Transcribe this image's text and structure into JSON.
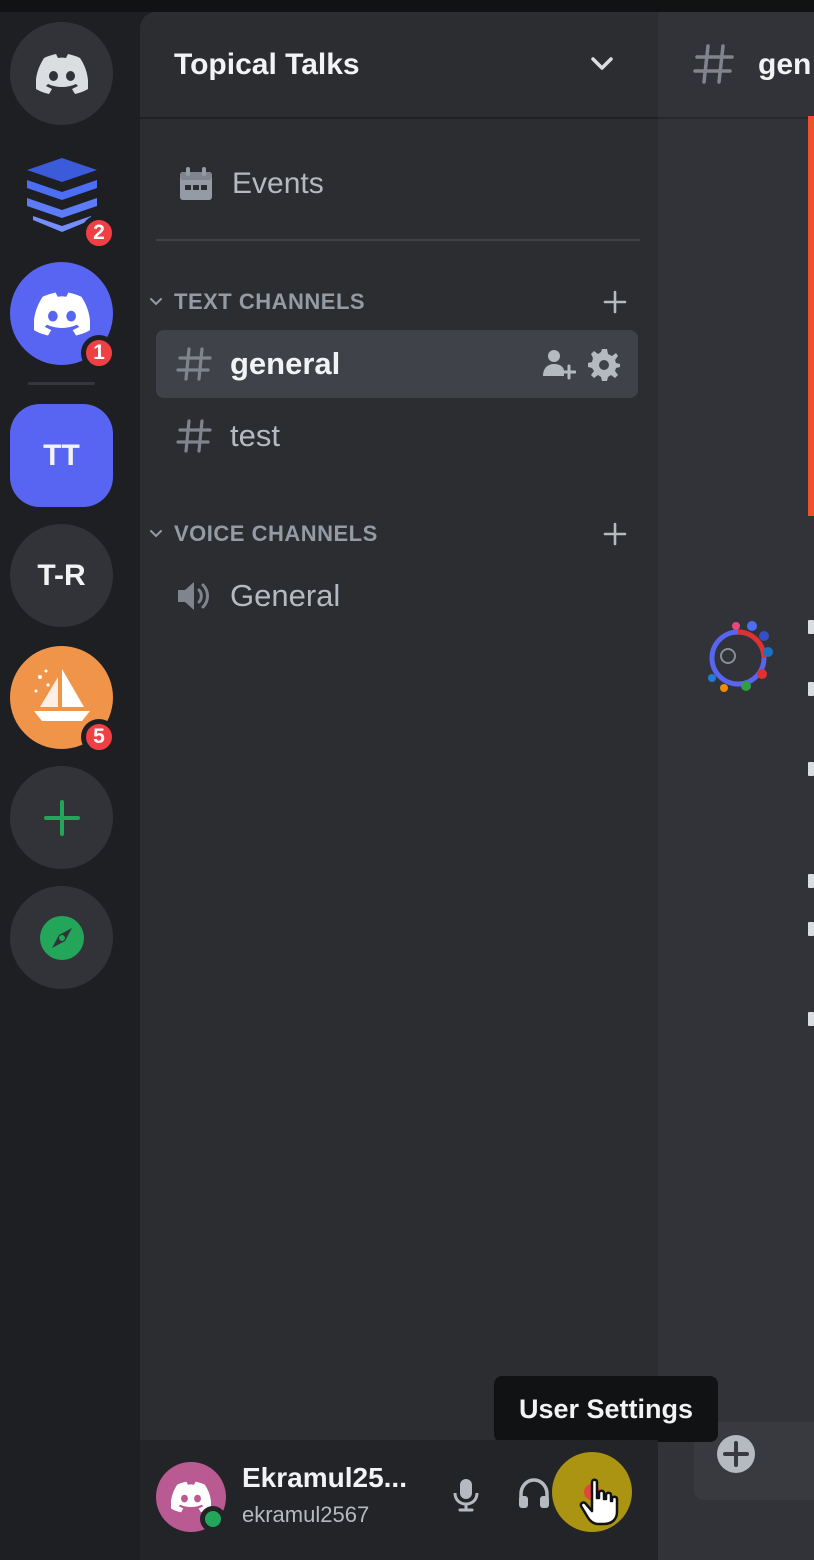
{
  "servers": [
    {
      "name": "discord-home",
      "label": ""
    },
    {
      "name": "layered-server",
      "label": "",
      "badge": "2"
    },
    {
      "name": "discord-server",
      "label": "",
      "badge": "1"
    },
    {
      "name": "tt-server",
      "label": "TT",
      "active": true
    },
    {
      "name": "tr-server",
      "label": "T-R"
    },
    {
      "name": "sailboat-server",
      "label": "",
      "badge": "5"
    }
  ],
  "guild": {
    "name": "Topical Talks"
  },
  "events_label": "Events",
  "categories": {
    "text": "TEXT CHANNELS",
    "voice": "VOICE CHANNELS"
  },
  "channels": {
    "general": "general",
    "test": "test",
    "voice_general": "General"
  },
  "user": {
    "display_name": "Ekramul25...",
    "handle": "ekramul2567",
    "status": "online"
  },
  "tooltip": "User Settings",
  "main": {
    "channel_fragment": "gen"
  },
  "colors": {
    "blurple": "#5865f2",
    "badge_red": "#f23f43",
    "online_green": "#23a55a",
    "avatar_pink": "#ba5a92"
  }
}
